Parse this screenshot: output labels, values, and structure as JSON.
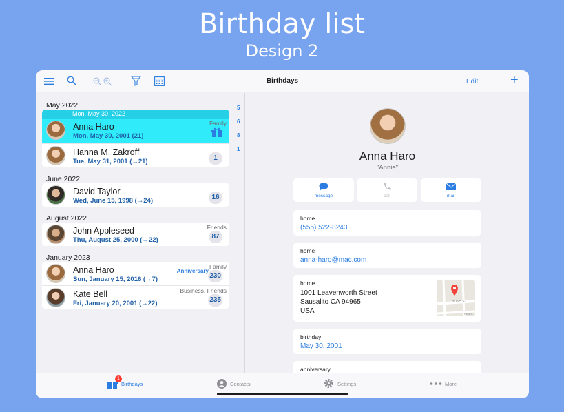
{
  "promo": {
    "title": "Birthday list",
    "subtitle": "Design 2"
  },
  "toolbar": {
    "title": "Birthdays",
    "edit_label": "Edit",
    "add_label": "+"
  },
  "list": {
    "sections": [
      {
        "month": "May 2022"
      },
      {
        "month": "June 2022"
      },
      {
        "month": "August 2022"
      },
      {
        "month": "January 2023"
      }
    ],
    "selected_banner": "Mon, May 30, 2022",
    "rows": [
      {
        "name": "Anna Haro",
        "date": "Mon, May 30, 2001 (21)",
        "tag": "Family",
        "badge": ""
      },
      {
        "name": "Hanna M. Zakroff",
        "date": "Tue, May 31, 2001 (→21)",
        "tag": "",
        "badge": "1"
      },
      {
        "name": "David Taylor",
        "date": "Wed, June 15, 1998 (→24)",
        "tag": "",
        "badge": "16"
      },
      {
        "name": "John Appleseed",
        "date": "Thu, August 25, 2000 (→22)",
        "tag": "Friends",
        "badge": "87"
      },
      {
        "name": "Anna Haro",
        "date": "Sun, January 15, 2016 (→7)",
        "tag": "Family",
        "extra": "Anniversary",
        "badge": "230"
      },
      {
        "name": "Kate Bell",
        "date": "Fri, January 20, 2001 (→22)",
        "tag": "Business, Friends",
        "badge": "235"
      }
    ],
    "index": [
      "5",
      "6",
      "8",
      "1"
    ]
  },
  "detail": {
    "name": "Anna Haro",
    "nickname": "\"Annie\"",
    "actions": [
      {
        "label": "message",
        "icon": "message-bubble-icon"
      },
      {
        "label": "call",
        "icon": "phone-icon"
      },
      {
        "label": "mail",
        "icon": "envelope-icon"
      }
    ],
    "fields": {
      "phone": {
        "label": "home",
        "value": "(555) 522-8243"
      },
      "email": {
        "label": "home",
        "value": "anna-haro@mac.com"
      },
      "address": {
        "label": "home",
        "line1": "1001  Leavenworth Street",
        "line2": "Sausalito CA 94965",
        "line3": "USA",
        "map_text": "BUSH ST",
        "map_text2": "PEARL"
      },
      "birthday": {
        "label": "birthday",
        "value": "May 30, 2001"
      },
      "anniversary": {
        "label": "anniversary"
      }
    }
  },
  "tabs": [
    {
      "label": "Birthdays",
      "badge": "1"
    },
    {
      "label": "Contacts"
    },
    {
      "label": "Settings"
    },
    {
      "label": "More"
    }
  ],
  "colors": {
    "accent": "#2b7de1",
    "selected_row": "#30ecfb",
    "background": "#78a3ef"
  }
}
